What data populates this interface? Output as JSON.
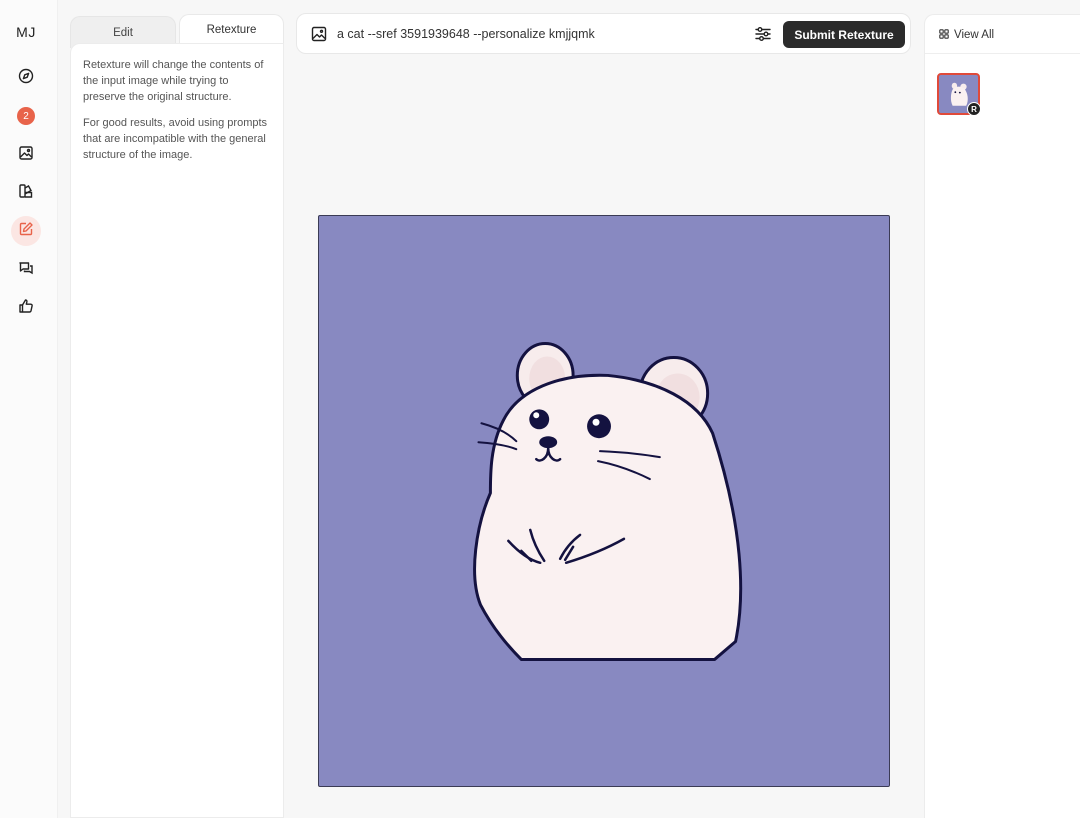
{
  "rail": {
    "logo": "MJ",
    "badge_count": "2",
    "items": [
      {
        "icon": "compass-icon"
      },
      {
        "icon": "notifications-badge"
      },
      {
        "icon": "image-icon"
      },
      {
        "icon": "palette-icon"
      },
      {
        "icon": "edit-icon",
        "active": true
      },
      {
        "icon": "chat-icon"
      },
      {
        "icon": "thumbs-up-icon"
      }
    ]
  },
  "panel": {
    "tabs": [
      {
        "label": "Edit"
      },
      {
        "label": "Retexture",
        "active": true
      }
    ],
    "paragraph_1": "Retexture will change the contents of the input image while trying to preserve the original structure.",
    "paragraph_2": "For good results, avoid using prompts that are incompatible with the general structure of the image."
  },
  "prompt_bar": {
    "value": "a cat --sref 3591939648 --personalize kmjjqmk",
    "submit_label": "Submit Retexture"
  },
  "right_panel": {
    "view_all_label": "View All",
    "thumb_badge": "R"
  },
  "colors": {
    "accent": "#e8634a",
    "image_background": "#8889c1",
    "button_dark": "#2b2b2b",
    "thumb_border": "#e04a3a"
  }
}
